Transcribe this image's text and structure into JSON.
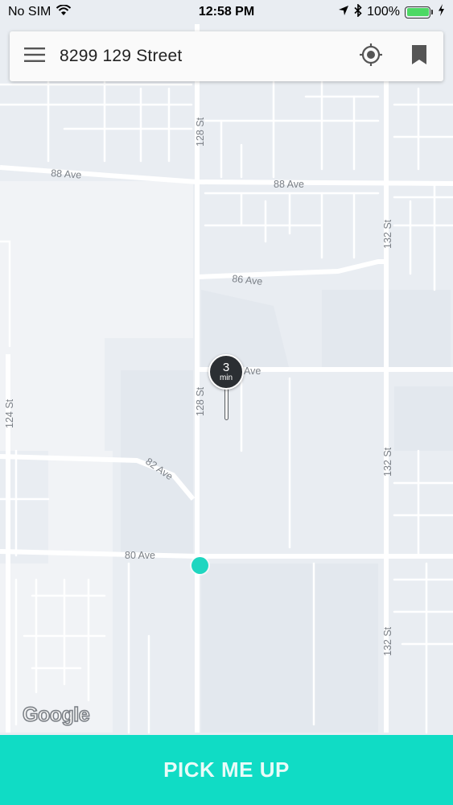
{
  "status_bar": {
    "carrier": "No SIM",
    "time": "12:58 PM",
    "battery_percent": "100%",
    "battery_level": 1.0
  },
  "search": {
    "address": "8299 129 Street"
  },
  "map": {
    "road_labels": {
      "ave_88_left": "88 Ave",
      "ave_88_right": "88 Ave",
      "ave_86": "86 Ave",
      "ave_84": "Ave",
      "ave_82": "82 Ave",
      "ave_80": "80 Ave",
      "st_128_top": "128 St",
      "st_128_mid": "128 St",
      "st_132_top": "132 St",
      "st_132_mid": "132 St",
      "st_132_bottom": "132 St",
      "st_124": "124 St"
    },
    "attribution": "Google"
  },
  "eta_pin": {
    "minutes": "3",
    "unit": "min"
  },
  "pickup_button": {
    "label": "PICK ME UP"
  },
  "colors": {
    "accent": "#10dcc5",
    "user_location": "#1fd6c0",
    "pin": "#2b2f33",
    "map_background": "#e9edf2",
    "road": "#ffffff"
  }
}
